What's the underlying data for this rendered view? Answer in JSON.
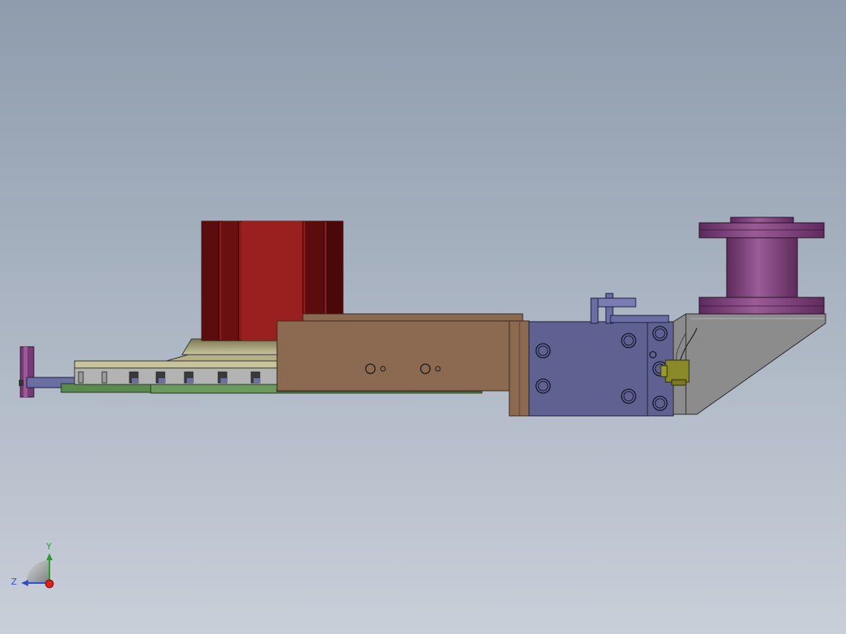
{
  "viewport": {
    "background_top": "#8e9cad",
    "background_bottom": "#c9cfd9"
  },
  "triad": {
    "y_label": "Y",
    "z_label": "Z",
    "x_color": "#e0201c",
    "y_color": "#27a027",
    "z_color": "#2a4ed8"
  },
  "colors": {
    "cylinder_red": "#8e1a1a",
    "cylinder_dark": "#5c0c0c",
    "slide_brown": "#8c6a52",
    "block_slate": "#5f6290",
    "bracket_grey": "#8c8c8c",
    "spool_purple": "#7a3a77",
    "plate_green": "#5a8a4e",
    "sensor_olive": "#8a8a2a",
    "base_khaki": "#aaa17c"
  }
}
